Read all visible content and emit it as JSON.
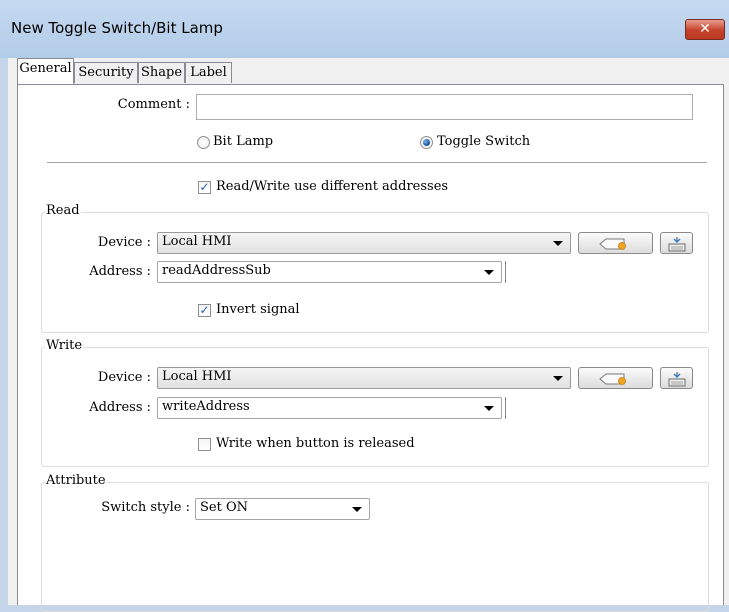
{
  "window": {
    "title": "New Toggle Switch/Bit Lamp",
    "close_symbol": "✕"
  },
  "tabs": [
    {
      "label": "General",
      "active": true
    },
    {
      "label": "Security",
      "active": false
    },
    {
      "label": "Shape",
      "active": false
    },
    {
      "label": "Label",
      "active": false
    }
  ],
  "general": {
    "comment_label": "Comment :",
    "comment_value": "",
    "mode_options": [
      {
        "label": "Bit Lamp",
        "selected": false
      },
      {
        "label": "Toggle Switch",
        "selected": true
      }
    ],
    "different_addresses": {
      "label": "Read/Write use different addresses",
      "checked": true
    }
  },
  "read": {
    "group_label": "Read",
    "device_label": "Device :",
    "device_value": "Local HMI",
    "address_label": "Address :",
    "address_value": "readAddressSub",
    "invert": {
      "label": "Invert signal",
      "checked": true
    }
  },
  "write": {
    "group_label": "Write",
    "device_label": "Device :",
    "device_value": "Local HMI",
    "address_label": "Address :",
    "address_value": "writeAddress",
    "release": {
      "label": "Write when button is released",
      "checked": false
    }
  },
  "attribute": {
    "group_label": "Attribute",
    "switch_style_label": "Switch style :",
    "switch_style_value": "Set ON"
  },
  "icons": {
    "close": "close-icon",
    "tag": "address-tag-icon",
    "keyboard": "keypad-icon",
    "dropdown": "chevron-down-icon"
  }
}
